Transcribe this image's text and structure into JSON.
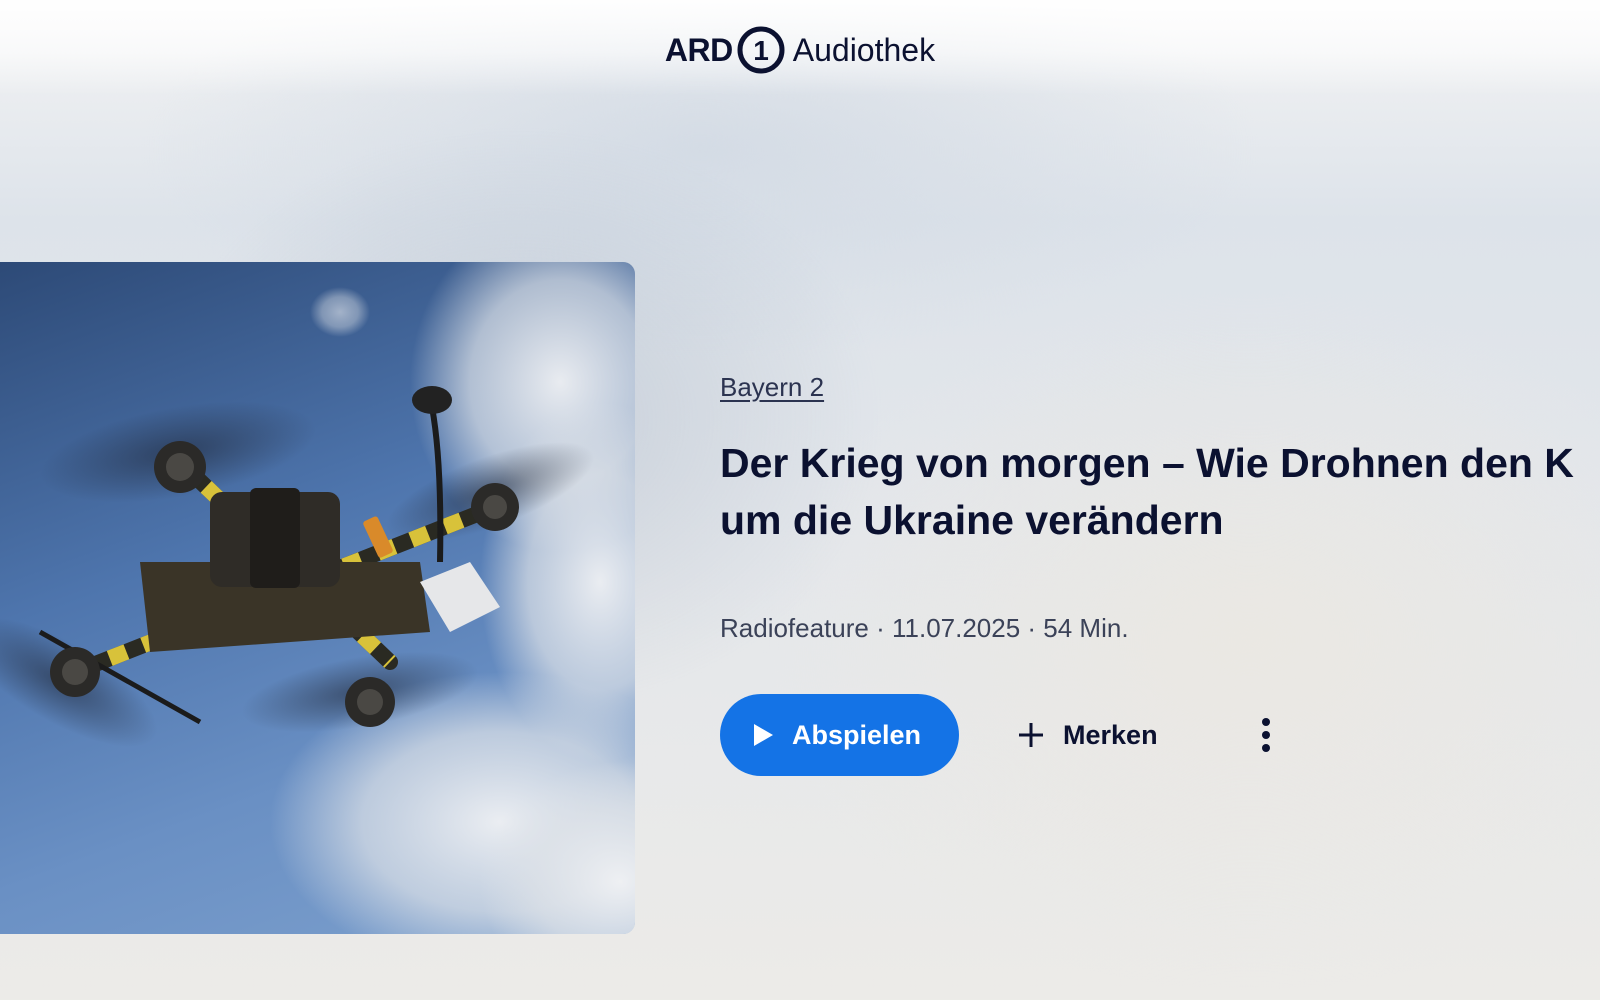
{
  "header": {
    "logo_ard": "ARD",
    "logo_one": "1",
    "logo_product": "Audiothek"
  },
  "episode": {
    "publisher": "Bayern 2",
    "title_line1": "Der Krieg von morgen – Wie Drohnen den K",
    "title_line2": "um die Ukraine verändern",
    "meta": "Radiofeature · 11.07.2025 · 54 Min.",
    "play_label": "Abspielen",
    "bookmark_label": "Merken"
  },
  "icons": {
    "play": "play-icon",
    "plus": "plus-icon",
    "more": "more-vertical-icon"
  },
  "colors": {
    "accent": "#1473e6",
    "text": "#0b1130"
  }
}
